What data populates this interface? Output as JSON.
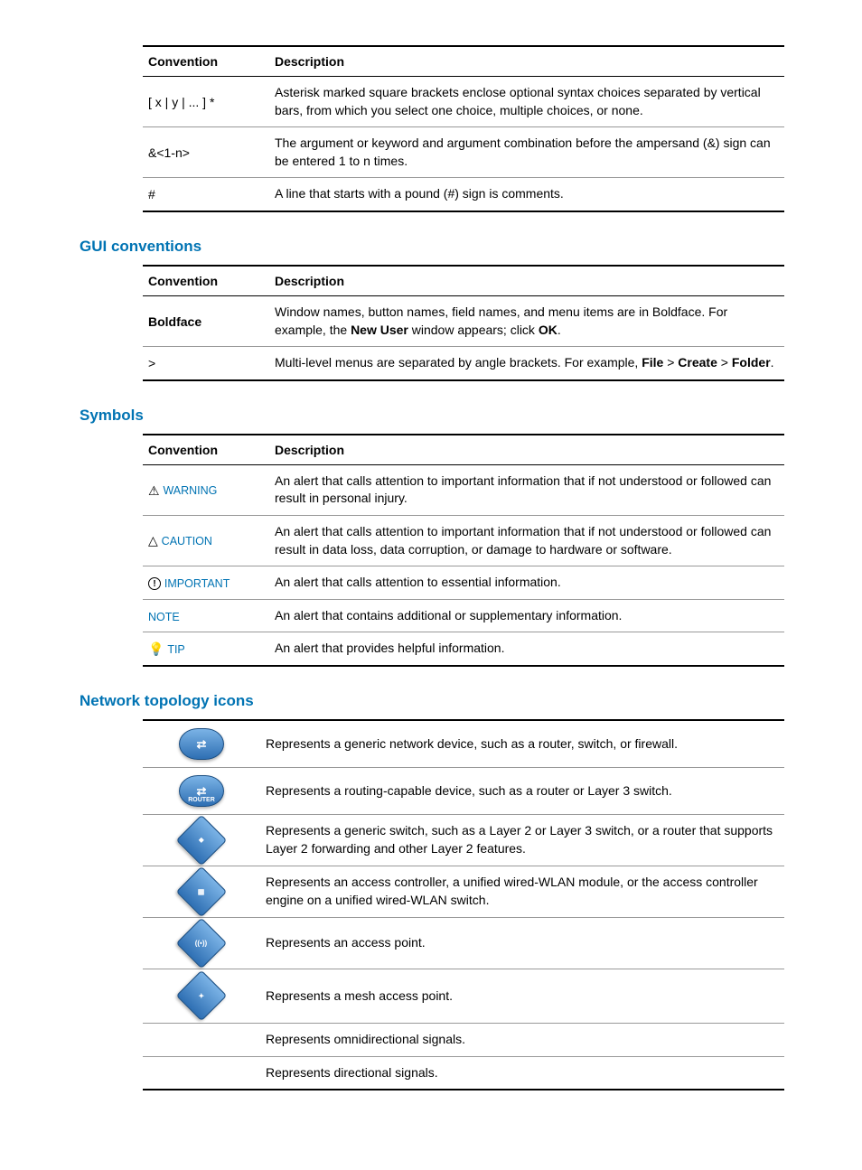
{
  "headers": {
    "conv": "Convention",
    "desc": "Description"
  },
  "sections": {
    "gui": "GUI conventions",
    "symbols": "Symbols",
    "network": "Network topology icons"
  },
  "table1": {
    "rows": [
      {
        "conv": "[ x | y | ... ] *",
        "desc": "Asterisk marked square brackets enclose optional syntax choices separated by vertical bars, from which you select one choice, multiple choices, or none."
      },
      {
        "conv": "&<1-n>",
        "desc": "The argument or keyword and argument combination before the ampersand (&) sign can be entered 1 to n times."
      },
      {
        "conv": "#",
        "desc": "A line that starts with a pound (#) sign is comments."
      }
    ]
  },
  "table2": {
    "rows": [
      {
        "conv": "Boldface",
        "desc_pre": "Window names, button names, field names, and menu items are in Boldface. For example, the ",
        "bold1": "New User",
        "mid": " window appears; click ",
        "bold2": "OK",
        "post": "."
      },
      {
        "conv": ">",
        "desc_pre": "Multi-level menus are separated by angle brackets. For example, ",
        "b1": "File",
        "s1": " > ",
        "b2": "Create",
        "s2": " > ",
        "b3": "Folder",
        "post": "."
      }
    ]
  },
  "table3": {
    "rows": [
      {
        "label": "WARNING",
        "desc": "An alert that calls attention to important information that if not understood or followed can result in personal injury."
      },
      {
        "label": "CAUTION",
        "desc": "An alert that calls attention to important information that if not understood or followed can result in data loss, data corruption, or damage to hardware or software."
      },
      {
        "label": "IMPORTANT",
        "desc": "An alert that calls attention to essential information."
      },
      {
        "label": "NOTE",
        "desc": "An alert that contains additional or supplementary information."
      },
      {
        "label": "TIP",
        "desc": "An alert that provides helpful information."
      }
    ]
  },
  "table4": {
    "rows": [
      {
        "icon": "generic-device",
        "desc": "Represents a generic network device, such as a router, switch, or firewall."
      },
      {
        "icon": "router",
        "desc": "Represents a routing-capable device, such as a router or Layer 3 switch."
      },
      {
        "icon": "switch",
        "desc": "Represents a generic switch, such as a Layer 2 or Layer 3 switch, or a router that supports Layer 2 forwarding and other Layer 2 features."
      },
      {
        "icon": "access-controller",
        "desc": "Represents an access controller, a unified wired-WLAN module, or the access controller engine on a unified wired-WLAN switch."
      },
      {
        "icon": "access-point",
        "desc": "Represents an access point."
      },
      {
        "icon": "mesh-ap",
        "desc": "Represents a mesh access point."
      },
      {
        "icon": "omni-signal",
        "desc": "Represents omnidirectional signals."
      },
      {
        "icon": "directional-signal",
        "desc": "Represents directional signals."
      }
    ]
  }
}
